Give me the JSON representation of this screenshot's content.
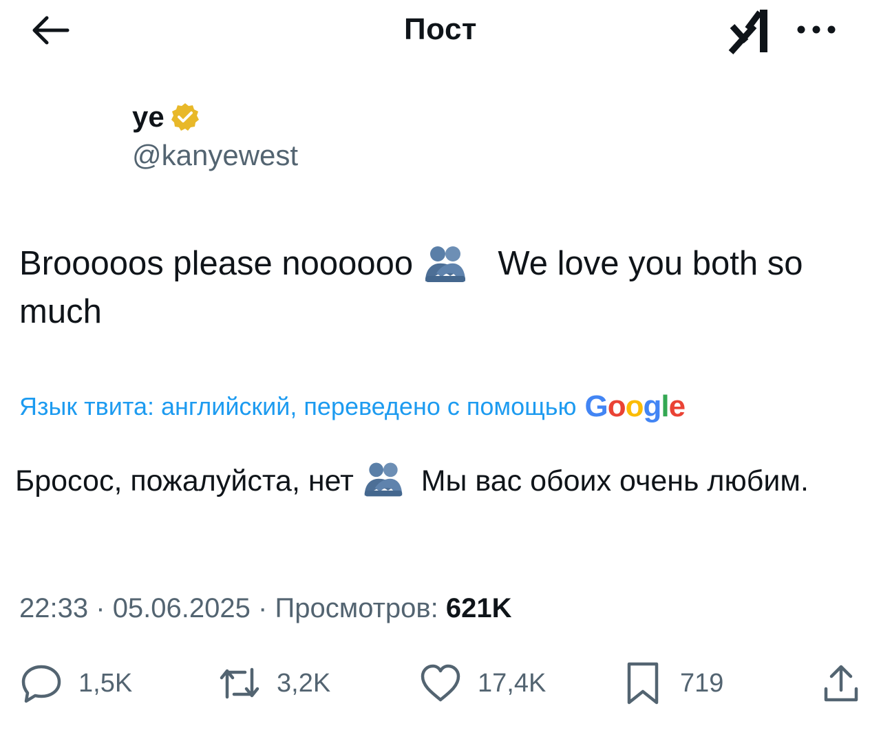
{
  "header": {
    "title": "Пост",
    "back_icon": "arrow-left-icon",
    "grok_icon": "grok-icon",
    "more_icon": "more-horizontal-icon"
  },
  "author": {
    "display_name": "ye",
    "handle": "@kanyewest",
    "verified_badge": "verified-gold-icon",
    "badge_color": "#e8b829"
  },
  "tweet": {
    "text_part1": "Brooooos please noooooo",
    "emoji": "people-hugging",
    "text_part2": "We love you both so much",
    "translate_label": "Язык твита: английский, переведено с помощью",
    "translated_part1": "Бросос, пожалуйста, нет",
    "translated_part2": "Мы вас обоих очень любим."
  },
  "meta": {
    "time": "22:33",
    "separator": "·",
    "date": "05.06.2025",
    "views_label": "Просмотров:",
    "views_count": "621K"
  },
  "actions": {
    "replies": "1,5K",
    "reposts": "3,2K",
    "likes": "17,4K",
    "bookmarks": "719"
  },
  "colors": {
    "link": "#1d9bf0",
    "secondary": "#536471",
    "text": "#0f1419"
  }
}
